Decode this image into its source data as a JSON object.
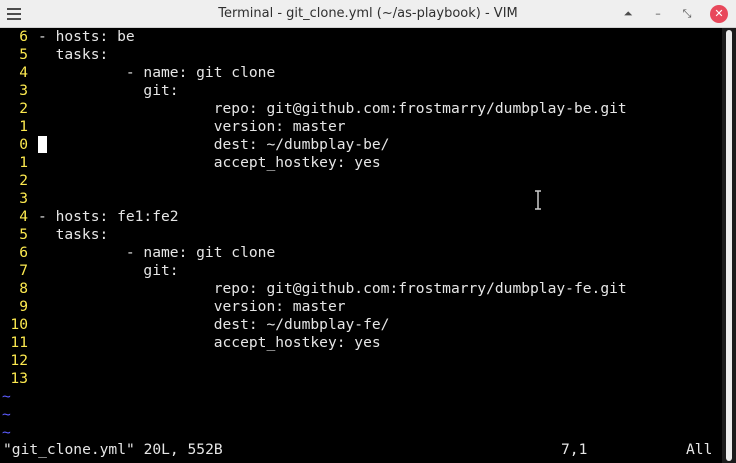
{
  "window": {
    "title": "Terminal - git_clone.yml (~/as-playbook) - VIM",
    "buttons": {
      "keep_above": "⏶",
      "minimize": "–",
      "maximize": "⤡",
      "close": "✕"
    }
  },
  "editor": {
    "lines": [
      {
        "num": "6",
        "text": "- hosts: be"
      },
      {
        "num": "5",
        "text": "  tasks:"
      },
      {
        "num": "4",
        "text": "          - name: git clone"
      },
      {
        "num": "3",
        "text": "            git:"
      },
      {
        "num": "2",
        "text": "                    repo: git@github.com:frostmarry/dumbplay-be.git"
      },
      {
        "num": "1",
        "text": "                    version: master"
      },
      {
        "num": "0",
        "text": "                    dest: ~/dumbplay-be/",
        "cursor": true
      },
      {
        "num": "1",
        "text": "                    accept_hostkey: yes"
      },
      {
        "num": "2",
        "text": ""
      },
      {
        "num": "3",
        "text": ""
      },
      {
        "num": "4",
        "text": "- hosts: fe1:fe2"
      },
      {
        "num": "5",
        "text": "  tasks:"
      },
      {
        "num": "6",
        "text": "          - name: git clone"
      },
      {
        "num": "7",
        "text": "            git:"
      },
      {
        "num": "8",
        "text": "                    repo: git@github.com:frostmarry/dumbplay-fe.git"
      },
      {
        "num": "9",
        "text": "                    version: master"
      },
      {
        "num": "10",
        "text": "                    dest: ~/dumbplay-fe/"
      },
      {
        "num": "11",
        "text": "                    accept_hostkey: yes"
      },
      {
        "num": "12",
        "text": ""
      },
      {
        "num": "13",
        "text": ""
      }
    ],
    "tilde_lines": [
      "~",
      "~",
      "~"
    ]
  },
  "status": {
    "file_info": "\"git_clone.yml\" 20L, 552B",
    "position": "7,1",
    "scroll": "All"
  },
  "colors": {
    "line_number": "#fce94f",
    "text": "#e6e6e6",
    "tilde": "#5c5cff",
    "background": "#000000",
    "close_button": "#e8485b"
  }
}
